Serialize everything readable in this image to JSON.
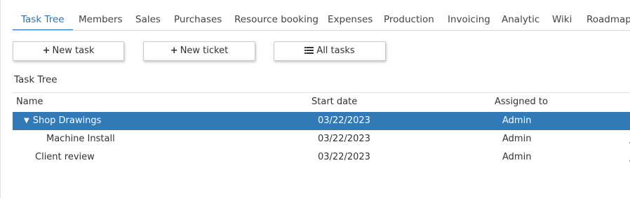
{
  "tabs": [
    {
      "label": "Task Tree",
      "active": true
    },
    {
      "label": "Members"
    },
    {
      "label": "Sales"
    },
    {
      "label": "Purchases"
    },
    {
      "label": "Resource booking"
    },
    {
      "label": "Expenses"
    },
    {
      "label": "Production"
    },
    {
      "label": "Invoicing"
    },
    {
      "label": "Analytic"
    },
    {
      "label": "Wiki"
    },
    {
      "label": "Roadmap"
    }
  ],
  "toolbar": {
    "new_task_icon": "+",
    "new_task_label": "New task",
    "new_ticket_icon": "+",
    "new_ticket_label": "New ticket",
    "all_tasks_icon": "list-icon",
    "all_tasks_label": "All tasks"
  },
  "section": {
    "title": "Task Tree"
  },
  "table": {
    "columns": [
      "Name",
      "Start date",
      "Assigned to"
    ],
    "rows": [
      {
        "name": "Shop Drawings",
        "start": "03/22/2023",
        "assigned": "Admin",
        "expanded": true,
        "selected": true
      },
      {
        "name": "Machine Install",
        "start": "03/22/2023",
        "assigned": "Admin"
      },
      {
        "name": "Client review",
        "start": "03/22/2023",
        "assigned": "Admin"
      }
    ]
  },
  "colors": {
    "accent": "#2a73b8",
    "selected_row": "#3279b7"
  },
  "icons": {
    "expand": "caret-down-icon"
  }
}
